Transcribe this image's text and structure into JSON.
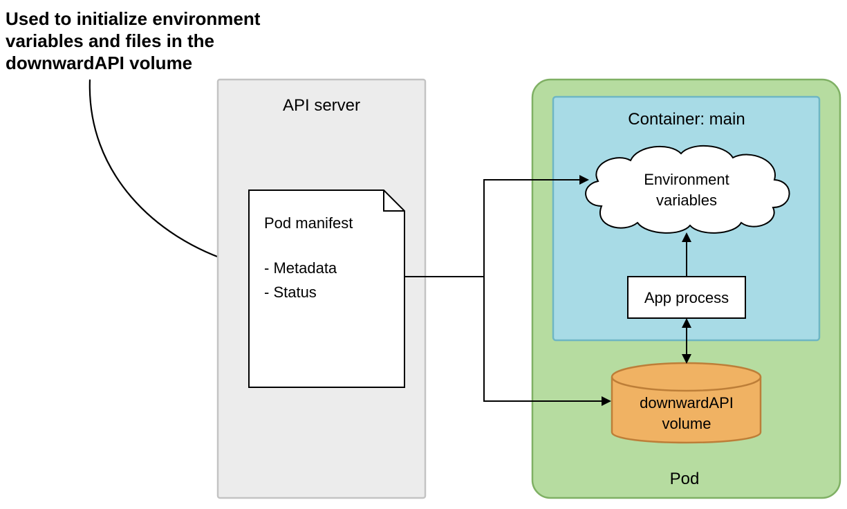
{
  "annotation": {
    "line1": "Used to initialize environment",
    "line2": "variables and files in the",
    "line3": "downwardAPI volume"
  },
  "api_server": {
    "label": "API server",
    "manifest": {
      "title": "Pod manifest",
      "item1": "- Metadata",
      "item2": "- Status"
    }
  },
  "pod": {
    "label": "Pod",
    "container": {
      "label": "Container: main",
      "env_label_line1": "Environment",
      "env_label_line2": "variables",
      "app_process_label": "App process"
    },
    "volume": {
      "label_line1": "downwardAPI",
      "label_line2": "volume"
    }
  },
  "colors": {
    "api_bg": "#ececec",
    "api_stroke": "#c3c3c3",
    "pod_bg": "#b6dca0",
    "pod_stroke": "#7fb064",
    "container_bg": "#a8dbe6",
    "container_stroke": "#6eb6c4",
    "volume_fill": "#f0b263",
    "volume_stroke": "#bd7e38",
    "line": "#333333"
  }
}
